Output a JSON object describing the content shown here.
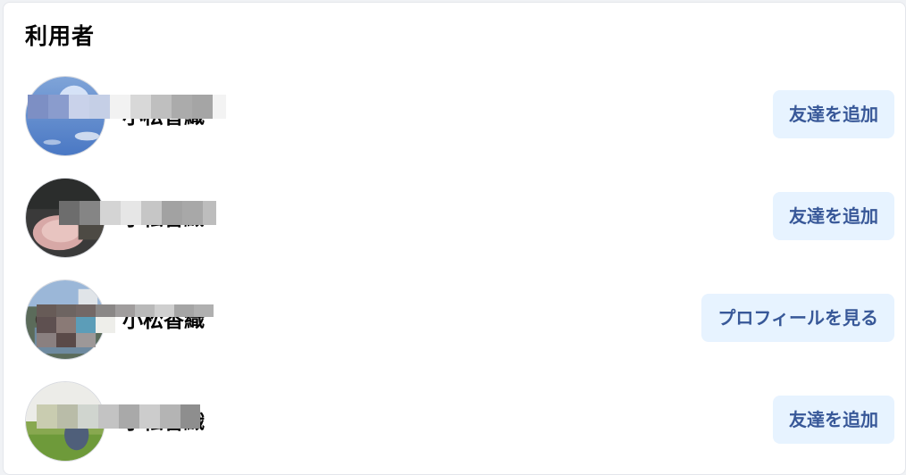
{
  "section": {
    "title": "利用者"
  },
  "users": [
    {
      "name": "小松香織",
      "action_label": "友達を追加",
      "avatar": "sky-photo"
    },
    {
      "name": "小松香織",
      "action_label": "友達を追加",
      "avatar": "food-photo"
    },
    {
      "name": "小松香織",
      "action_label": "プロフィールを見る",
      "avatar": "group-photo"
    },
    {
      "name": "小松香織",
      "action_label": "友達を追加",
      "avatar": "field-photo"
    }
  ],
  "colors": {
    "button_bg": "#e7f3ff",
    "button_text": "#385898",
    "title_text": "#050505"
  }
}
